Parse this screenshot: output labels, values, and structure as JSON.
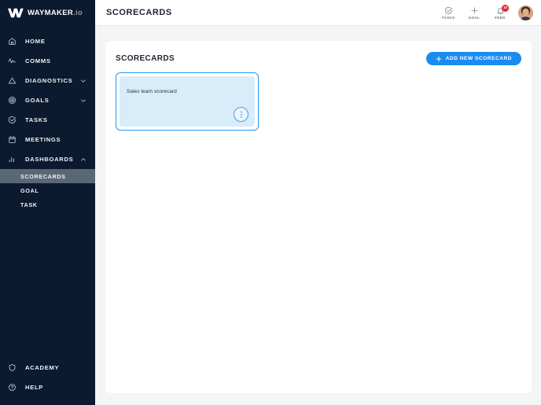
{
  "sidebar": {
    "logo": {
      "name": "WAYMAKER",
      "suffix": ".io"
    },
    "items": [
      {
        "label": "HOME",
        "icon": "home-icon",
        "expandable": false
      },
      {
        "label": "COMMS",
        "icon": "pulse-icon",
        "expandable": false
      },
      {
        "label": "DIAGNOSTICS",
        "icon": "triangle-icon",
        "expandable": true,
        "expanded": false
      },
      {
        "label": "GOALS",
        "icon": "target-icon",
        "expandable": true,
        "expanded": false
      },
      {
        "label": "TASKS",
        "icon": "check-circle-icon",
        "expandable": false
      },
      {
        "label": "MEETINGS",
        "icon": "calendar-icon",
        "expandable": false
      },
      {
        "label": "DASHBOARDS",
        "icon": "bar-chart-icon",
        "expandable": true,
        "expanded": true
      }
    ],
    "dashboards_subitems": [
      {
        "label": "SCORECARDS",
        "active": true
      },
      {
        "label": "GOAL",
        "active": false
      },
      {
        "label": "TASK",
        "active": false
      }
    ],
    "bottom_items": [
      {
        "label": "ACADEMY",
        "icon": "shield-icon"
      },
      {
        "label": "HELP",
        "icon": "help-circle-icon"
      }
    ]
  },
  "topbar": {
    "title": "SCORECARDS",
    "actions": [
      {
        "label": "TASKS",
        "icon": "check-circle-icon",
        "badge": ""
      },
      {
        "label": "GOAL",
        "icon": "plus-icon",
        "badge": ""
      },
      {
        "label": "FEED",
        "icon": "bell-icon",
        "badge": "10"
      }
    ]
  },
  "panel": {
    "title": "SCORECARDS",
    "add_button_label": "ADD NEW SCORECARD",
    "cards": [
      {
        "title": "Sales team scorecard"
      }
    ]
  },
  "colors": {
    "sidebar_bg": "#0b1a2e",
    "accent_blue": "#1a8cf0",
    "card_border": "#2196f3",
    "card_fill": "#d9ecfa",
    "badge_red": "#e8232a",
    "active_nav": "#5a6876"
  }
}
